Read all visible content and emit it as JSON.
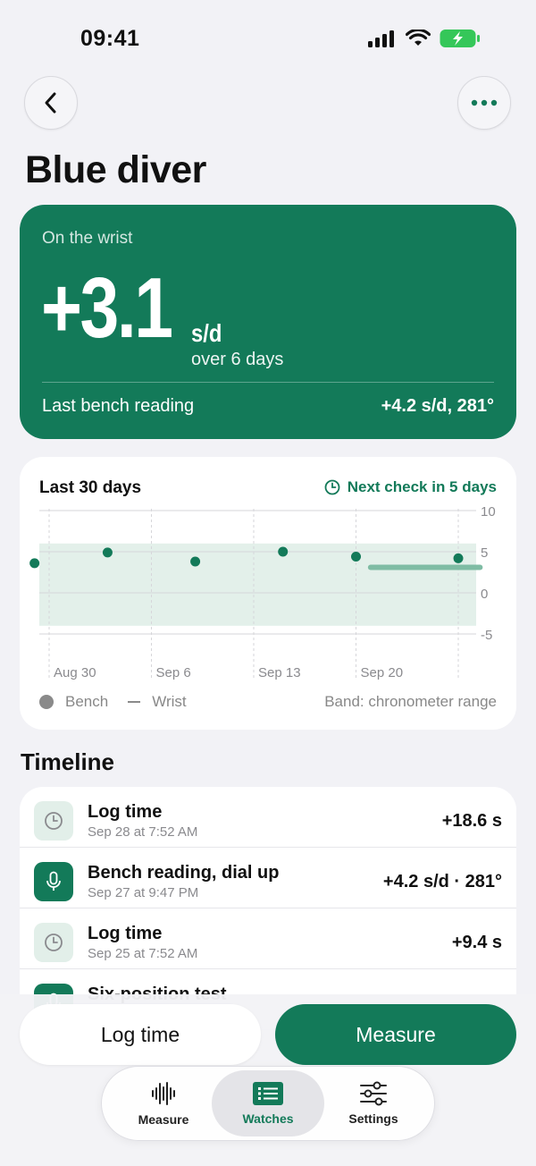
{
  "status_bar": {
    "time": "09:41",
    "signal_icon": "signal-icon",
    "wifi_icon": "wifi-icon",
    "battery_icon": "battery-charging-icon"
  },
  "nav": {
    "back_icon": "chevron-left-icon",
    "more_icon": "more-horizontal-icon"
  },
  "page_title": "Blue diver",
  "hero": {
    "label": "On the wrist",
    "value": "+3.1",
    "unit": "s/d",
    "sub": "over 6 days",
    "foot_label": "Last bench reading",
    "foot_value": "+4.2 s/d, 281°",
    "color": "#137a59"
  },
  "chart_card": {
    "title": "Last 30 days",
    "next_check": "Next check in 5 days",
    "legend": {
      "bench": "Bench",
      "wrist": "Wrist",
      "band": "Band: chronometer range"
    }
  },
  "chart_data": {
    "type": "scatter",
    "title": "Last 30 days",
    "x_tick_labels": [
      "Aug 30",
      "Sep 6",
      "Sep 13",
      "Sep 20"
    ],
    "y_ticks": [
      10,
      5,
      0,
      -5
    ],
    "ylim": [
      -5,
      10
    ],
    "band": {
      "label": "Band: chronometer range",
      "from": -4,
      "to": 6
    },
    "series": [
      {
        "name": "Bench",
        "kind": "points",
        "x": [
          "Aug 29",
          "Sep 3",
          "Sep 9",
          "Sep 15",
          "Sep 20",
          "Sep 27"
        ],
        "y": [
          3.6,
          4.9,
          3.8,
          5.0,
          4.4,
          4.2
        ]
      },
      {
        "name": "Wrist",
        "kind": "line",
        "x": [
          "Sep 21",
          "Sep 28"
        ],
        "y": [
          3.1,
          3.1
        ]
      }
    ],
    "grid": true,
    "legend_position": "bottom"
  },
  "timeline": {
    "title": "Timeline",
    "items": [
      {
        "icon": "clock-icon",
        "title": "Log time",
        "sub": "Sep 28 at 7:52 AM",
        "value": "+18.6 s"
      },
      {
        "icon": "microphone-icon",
        "title": "Bench reading, dial up",
        "sub": "Sep 27 at 9:47 PM",
        "value": "+4.2 s/d · 281°"
      },
      {
        "icon": "clock-icon",
        "title": "Log time",
        "sub": "Sep 25 at 7:52 AM",
        "value": "+9.4 s"
      },
      {
        "icon": "microphone-icon",
        "title": "Six-position test",
        "sub": "",
        "value": ""
      }
    ]
  },
  "actions": {
    "log_time": "Log time",
    "measure": "Measure"
  },
  "tabbar": {
    "measure": {
      "label": "Measure",
      "icon": "waveform-icon"
    },
    "watches": {
      "label": "Watches",
      "icon": "list-icon"
    },
    "settings": {
      "label": "Settings",
      "icon": "sliders-icon"
    }
  }
}
